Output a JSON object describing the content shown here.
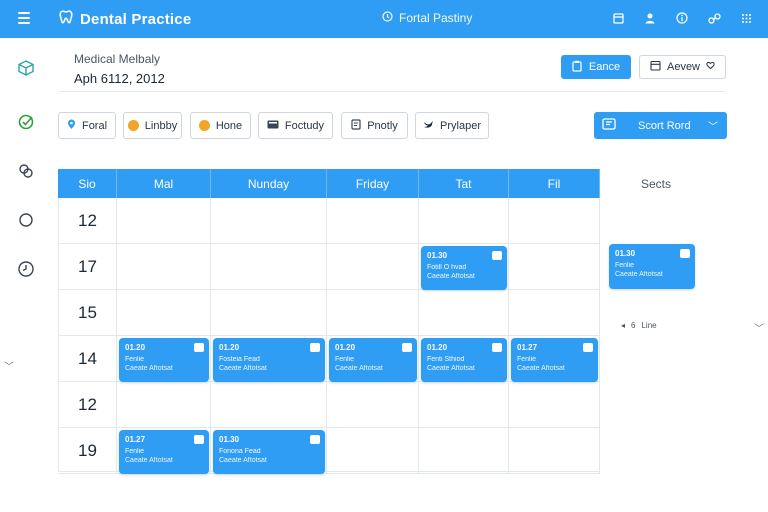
{
  "app": {
    "title": "Dental Practice",
    "center_title": "Fortal Pastiny"
  },
  "top_icons": [
    "calendar-icon",
    "user-icon",
    "info-icon",
    "link-icon",
    "grid-icon"
  ],
  "rail_icons": [
    "cube-icon",
    "check-icon",
    "group-icon",
    "circle-icon",
    "clock-icon"
  ],
  "header": {
    "label": "Medical Melbaly",
    "date": "Aph 6112, 2012"
  },
  "actions": {
    "primary": "Eance",
    "secondary": "Aevew"
  },
  "chips": [
    {
      "label": "Foral",
      "icon": "pin-icon"
    },
    {
      "label": "Linbby",
      "icon": "orange-dot-icon"
    },
    {
      "label": "Hone",
      "icon": "badge-icon"
    },
    {
      "label": "Foctudy",
      "icon": "screen-icon"
    },
    {
      "label": "Pnotly",
      "icon": "tag-icon"
    },
    {
      "label": "Prylaper",
      "icon": "bird-icon"
    }
  ],
  "scan_button": {
    "label": "Scort Rord"
  },
  "calendar": {
    "columns": [
      "Sio",
      "Mal",
      "Nunday",
      "Friday",
      "Tat",
      "Fil"
    ],
    "slots_header": "Sects",
    "rows": [
      "12",
      "17",
      "15",
      "14",
      "12",
      "19"
    ],
    "events": [
      {
        "row": 1,
        "col": 4,
        "time": "01.30",
        "name": "Fotill O hvad",
        "sub": "Caeate Aftotsat"
      },
      {
        "row": 3,
        "col": 1,
        "time": "01.20",
        "name": "Fenlie",
        "sub": "Caeate Aftotsat"
      },
      {
        "row": 3,
        "col": 2,
        "time": "01.20",
        "name": "Fosteia Fead",
        "sub": "Caeate Aftotsat"
      },
      {
        "row": 3,
        "col": 3,
        "time": "01.20",
        "name": "Fenlie",
        "sub": "Caeate Aftotsat"
      },
      {
        "row": 3,
        "col": 4,
        "time": "01.20",
        "name": "Fenti Sthiod",
        "sub": "Caeate Aftotsat"
      },
      {
        "row": 3,
        "col": 5,
        "time": "01.27",
        "name": "Fenlie",
        "sub": "Caeate Aftotsat"
      },
      {
        "row": 5,
        "col": 1,
        "time": "01.27",
        "name": "Fenlie",
        "sub": "Caeate Aftotsat"
      },
      {
        "row": 5,
        "col": 2,
        "time": "01.30",
        "name": "Fonona Fead",
        "sub": "Caeate Aftotsat"
      }
    ],
    "side_event": {
      "time": "01.30",
      "name": "Fenlie",
      "sub": "Caeate Aftotsat"
    },
    "side_line": {
      "arrow": "◂",
      "num": "6",
      "text": "Line"
    }
  },
  "colors": {
    "accent": "#2f9df4",
    "rail_icon": "#2aa6a0",
    "border": "#e3e8ee"
  }
}
